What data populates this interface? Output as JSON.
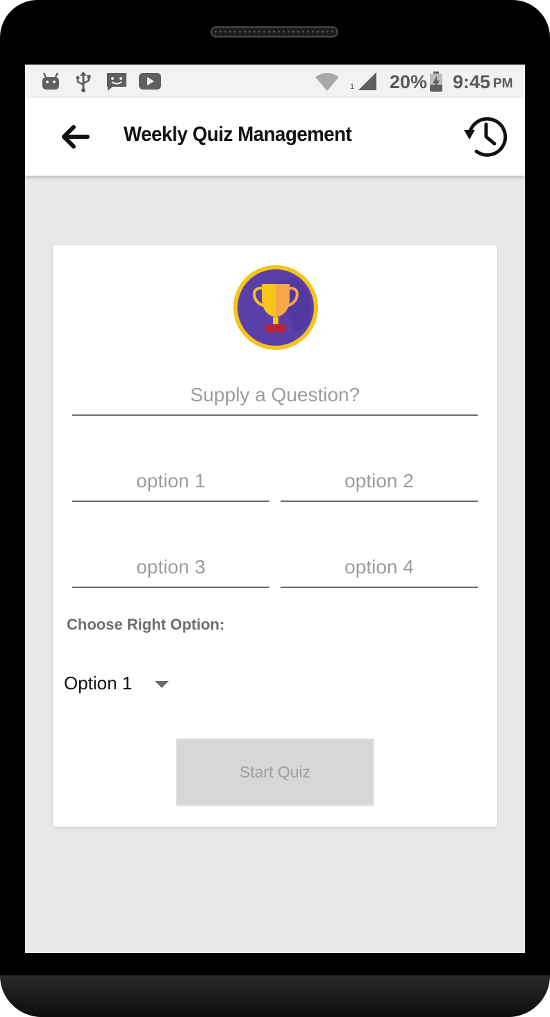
{
  "status_bar": {
    "battery": "20%",
    "time": "9:45",
    "ampm": "PM",
    "signal_sub": "1",
    "icons": [
      "android-debug-icon",
      "usb-icon",
      "message-icon",
      "youtube-icon",
      "wifi-icon",
      "signal-icon",
      "battery-charging-icon"
    ]
  },
  "app_bar": {
    "title": "Weekly Quiz Management",
    "back_icon": "arrow-back-icon",
    "history_icon": "history-icon"
  },
  "form": {
    "question_placeholder": "Supply a Question?",
    "option1_placeholder": "option 1",
    "option2_placeholder": "option 2",
    "option3_placeholder": "option 3",
    "option4_placeholder": "option 4",
    "choose_label": "Choose Right Option:",
    "selected_option": "Option 1",
    "start_button": "Start Quiz"
  },
  "colors": {
    "trophy_bg": "#5B3FA8",
    "trophy_ring": "#F5C518",
    "trophy_cup": "#F5C518",
    "trophy_base": "#B5253A",
    "screen_bg": "#E8E8E8",
    "button_bg": "#D6D7D7"
  }
}
